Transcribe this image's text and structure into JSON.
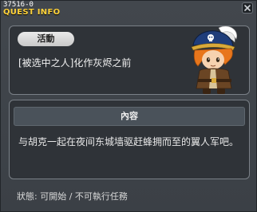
{
  "window": {
    "id_text": "37516-0",
    "title": "QUEST INFO"
  },
  "quest": {
    "badge": "活動",
    "name": "[被选中之人]化作灰烬之前"
  },
  "content": {
    "header": "內容",
    "description": "与胡克一起在夜间东城墙驱赶蜂拥而至的翼人军吧。"
  },
  "status_text": "狀態: 可開始 / 不可執行任務",
  "colors": {
    "title": "#ffd23a",
    "background": "#3b4046",
    "panel": "#2f3338",
    "section_header": "#4a525a"
  },
  "icons": [
    "close-icon",
    "npc-portrait"
  ]
}
